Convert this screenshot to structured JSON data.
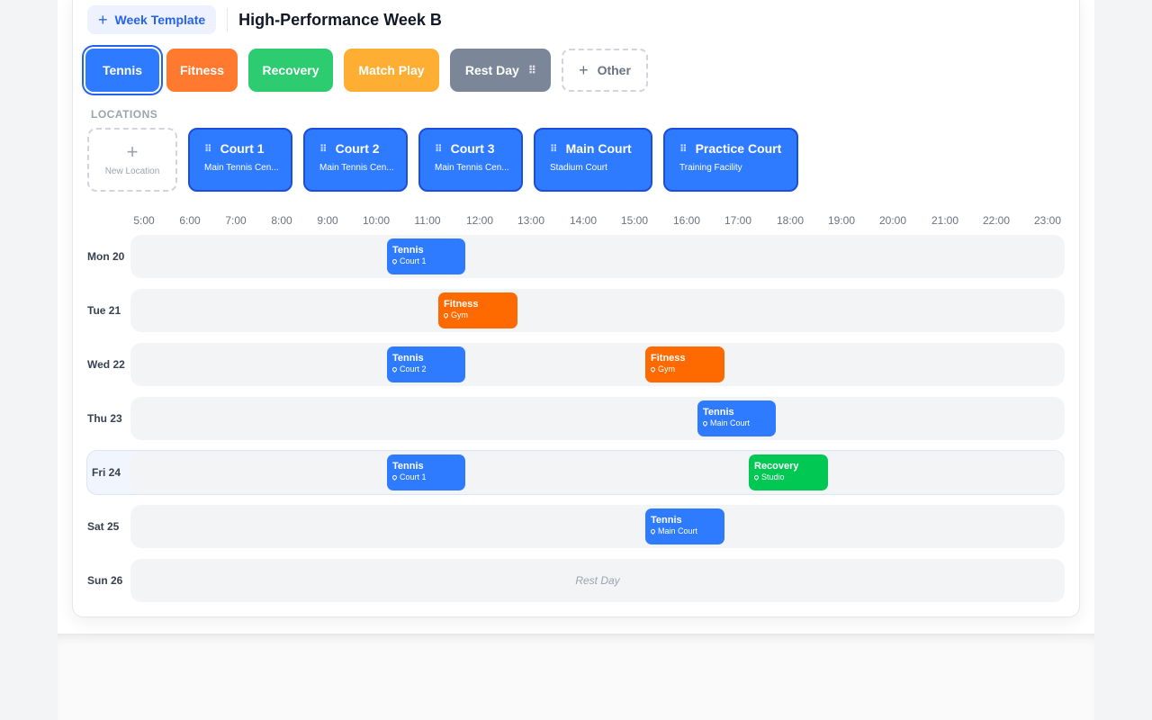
{
  "header": {
    "template_button": "Week Template",
    "title": "High-Performance Week B",
    "plus": "+"
  },
  "colors": {
    "Tennis": "#2f7bff",
    "Fitness": "#ff6a00",
    "Recovery": "#00c853",
    "Match Play": "#ffa726",
    "Rest Day": "#7b8798"
  },
  "session_types": [
    {
      "label": "Tennis",
      "color": "#2f7bff",
      "selected": true
    },
    {
      "label": "Fitness",
      "color": "#ff7a2f"
    },
    {
      "label": "Recovery",
      "color": "#2ecc71"
    },
    {
      "label": "Match Play",
      "color": "#ffae34"
    },
    {
      "label": "Rest Day",
      "color": "#7b8798",
      "grip": "⠿"
    },
    {
      "label": "Other",
      "dashed": true
    }
  ],
  "locations": {
    "label": "LOCATIONS",
    "new_label": "New Location",
    "items": [
      {
        "name": "Court 1",
        "sub": "Main Tennis Cen..."
      },
      {
        "name": "Court 2",
        "sub": "Main Tennis Cen..."
      },
      {
        "name": "Court 3",
        "sub": "Main Tennis Cen..."
      },
      {
        "name": "Main Court",
        "sub": "Stadium Court"
      },
      {
        "name": "Practice Court",
        "sub": "Training Facility"
      }
    ]
  },
  "hours": [
    "5:00",
    "6:00",
    "7:00",
    "8:00",
    "9:00",
    "10:00",
    "11:00",
    "12:00",
    "13:00",
    "14:00",
    "15:00",
    "16:00",
    "17:00",
    "18:00",
    "19:00",
    "20:00",
    "21:00",
    "22:00",
    "23:00"
  ],
  "days": [
    {
      "label": "Mon 20",
      "events": [
        {
          "title": "Tennis",
          "location": "Court 1",
          "start": 10.0,
          "end": 11.5
        }
      ]
    },
    {
      "label": "Tue 21",
      "events": [
        {
          "title": "Fitness",
          "location": "Gym",
          "start": 11.0,
          "end": 12.5
        }
      ]
    },
    {
      "label": "Wed 22",
      "events": [
        {
          "title": "Tennis",
          "location": "Court 2",
          "start": 10.0,
          "end": 11.5
        },
        {
          "title": "Fitness",
          "location": "Gym",
          "start": 15.0,
          "end": 16.5
        }
      ]
    },
    {
      "label": "Thu 23",
      "events": [
        {
          "title": "Tennis",
          "location": "Main Court",
          "start": 16.0,
          "end": 17.5
        }
      ]
    },
    {
      "label": "Fri 24",
      "highlight": true,
      "events": [
        {
          "title": "Tennis",
          "location": "Court 1",
          "start": 10.0,
          "end": 11.5
        },
        {
          "title": "Recovery",
          "location": "Studio",
          "start": 17.0,
          "end": 18.5
        }
      ]
    },
    {
      "label": "Sat 25",
      "events": [
        {
          "title": "Tennis",
          "location": "Main Court",
          "start": 15.0,
          "end": 16.5
        }
      ]
    },
    {
      "label": "Sun 26",
      "rest": "Rest Day",
      "events": []
    }
  ]
}
